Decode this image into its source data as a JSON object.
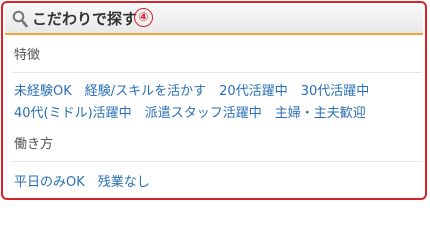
{
  "panel": {
    "title": "こだわりで探す",
    "marker": "④",
    "accent_color": "#d7242a",
    "header_rule_color": "#f0a33a",
    "link_color": "#2a6fb5",
    "icon": "search-icon"
  },
  "sections": [
    {
      "label": "特徴",
      "rows": [
        [
          "未経験OK",
          "経験/スキルを活かす",
          "20代活躍中",
          "30代活躍中"
        ],
        [
          "40代(ミドル)活躍中",
          "派遣スタッフ活躍中",
          "主婦・主夫歓迎"
        ]
      ]
    },
    {
      "label": "働き方",
      "rows": [
        [
          "平日のみOK",
          "残業なし"
        ]
      ]
    }
  ]
}
